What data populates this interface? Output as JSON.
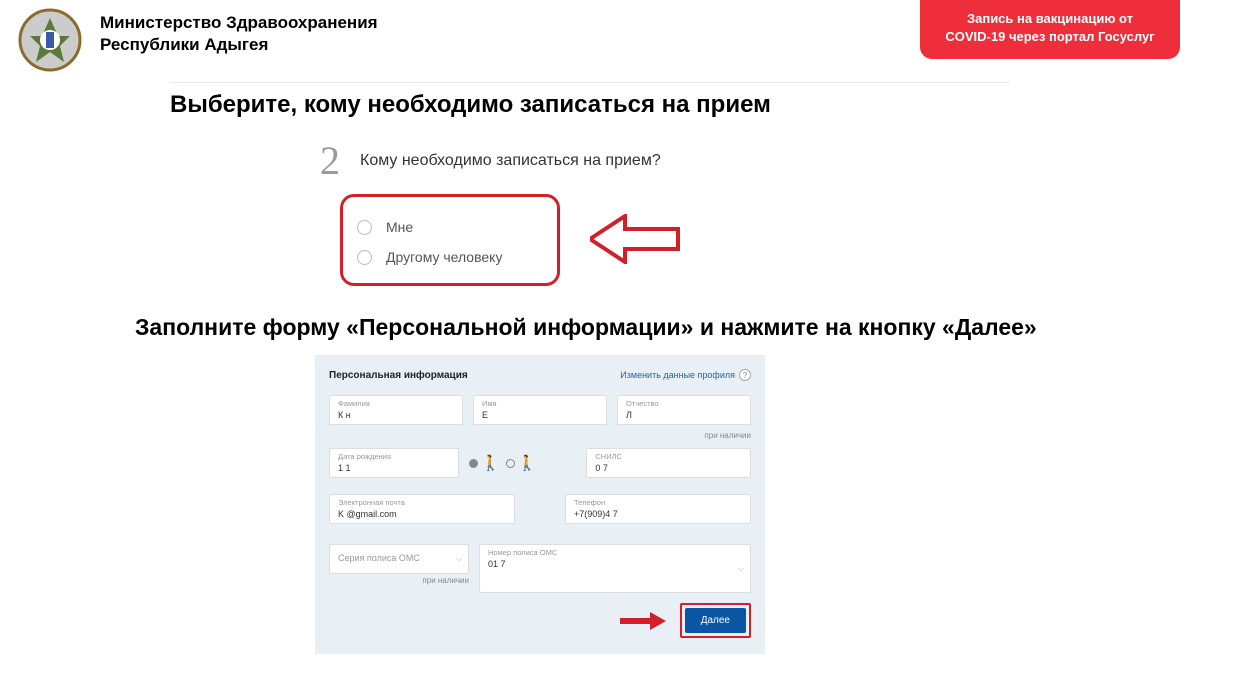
{
  "header": {
    "ministry_line1": "Министерство Здравоохранения",
    "ministry_line2": "Республики Адыгея"
  },
  "ribbon": {
    "line1": "Запись на вакцинацию от",
    "line2": "COVID-19 через портал Госуслуг"
  },
  "step": {
    "number": "2",
    "heading": "Выберите, кому необходимо записаться на прием",
    "question": "Кому необходимо записаться на прием?",
    "options": [
      "Мне",
      "Другому человеку"
    ]
  },
  "instruction2": "Заполните форму «Персональной информации» и нажмите на кнопку «Далее»",
  "form": {
    "title": "Персональная информация",
    "edit_link": "Изменить данные профиля",
    "note_optional": "при наличии",
    "fields": {
      "surname": {
        "label": "Фамилия",
        "value": "К          н"
      },
      "name": {
        "label": "Имя",
        "value": "Е"
      },
      "patronym": {
        "label": "Отчество",
        "value": "Л"
      },
      "dob": {
        "label": "Дата рождения",
        "value": "1           1"
      },
      "snils": {
        "label": "СНИЛС",
        "value": "0                    7"
      },
      "email": {
        "label": "Электронная почта",
        "value": "K            @gmail.com"
      },
      "phone": {
        "label": "Телефон",
        "value": "+7(909)4        7"
      },
      "oms_series": {
        "label": "Серия полиса ОМС",
        "value": ""
      },
      "oms_number": {
        "label": "Номер полиса ОМС",
        "value": "01               7"
      }
    },
    "next_button": "Далее"
  }
}
